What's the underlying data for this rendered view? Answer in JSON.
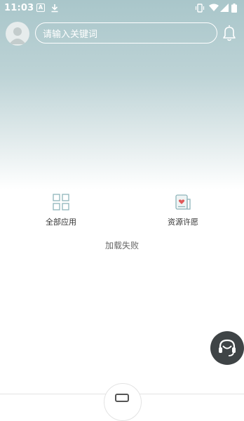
{
  "status_bar": {
    "time": "11:03",
    "icons": [
      "a-badge-icon",
      "download-icon",
      "vibrate-icon",
      "wifi-icon",
      "signal-icon",
      "battery-icon"
    ]
  },
  "header": {
    "avatar_icon": "avatar-placeholder-icon",
    "search_placeholder": "请输入关键词",
    "notification_icon": "bell-icon"
  },
  "shortcuts": [
    {
      "label": "全部应用",
      "icon": "grid-icon"
    },
    {
      "label": "资源许愿",
      "icon": "wish-card-icon"
    }
  ],
  "message": "加载失败",
  "floating": {
    "icon": "headset-support-icon"
  },
  "colors": {
    "hero_top": "#a9c6ca",
    "accent": "#e05a5a",
    "fab_bg": "#3f4446"
  }
}
